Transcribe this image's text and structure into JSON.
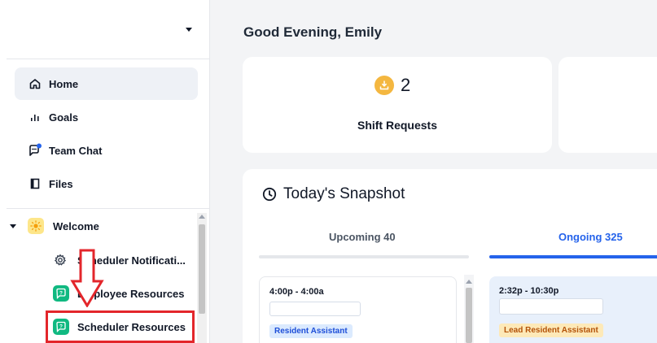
{
  "sidebar": {
    "nav": [
      {
        "label": "Home",
        "icon": "home-icon",
        "active": true
      },
      {
        "label": "Goals",
        "icon": "bar-chart-icon"
      },
      {
        "label": "Team Chat",
        "icon": "chat-bubble-icon",
        "has_notification_dot": true
      },
      {
        "label": "Files",
        "icon": "file-icon"
      }
    ],
    "tree": {
      "group_label": "Welcome",
      "group_icon": "sun-icon",
      "items": [
        {
          "label": "Scheduler Notificati...",
          "icon": "gear-icon"
        },
        {
          "label": "Employee Resources",
          "icon": "chat-question-icon"
        },
        {
          "label": "Scheduler Resources",
          "icon": "chat-question-icon",
          "highlighted": true
        }
      ]
    }
  },
  "main": {
    "greeting": "Good Evening, Emily",
    "shift_requests": {
      "count": "2",
      "label": "Shift Requests",
      "icon": "inbox-download-icon"
    },
    "snapshot": {
      "title": "Today's Snapshot",
      "icon": "clock-icon",
      "tabs": [
        {
          "label": "Upcoming 40",
          "active": false
        },
        {
          "label": "Ongoing 325",
          "active": true
        }
      ],
      "upcoming_card": {
        "time": "4:00p - 4:00a",
        "role": "Resident Assistant"
      },
      "ongoing_card": {
        "time": "2:32p - 10:30p",
        "role": "Lead Resident Assistant"
      }
    }
  },
  "colors": {
    "accent_blue": "#2563eb",
    "highlight_red": "#e3262b",
    "badge_amber": "#f4b740",
    "chat_green": "#10b981"
  }
}
